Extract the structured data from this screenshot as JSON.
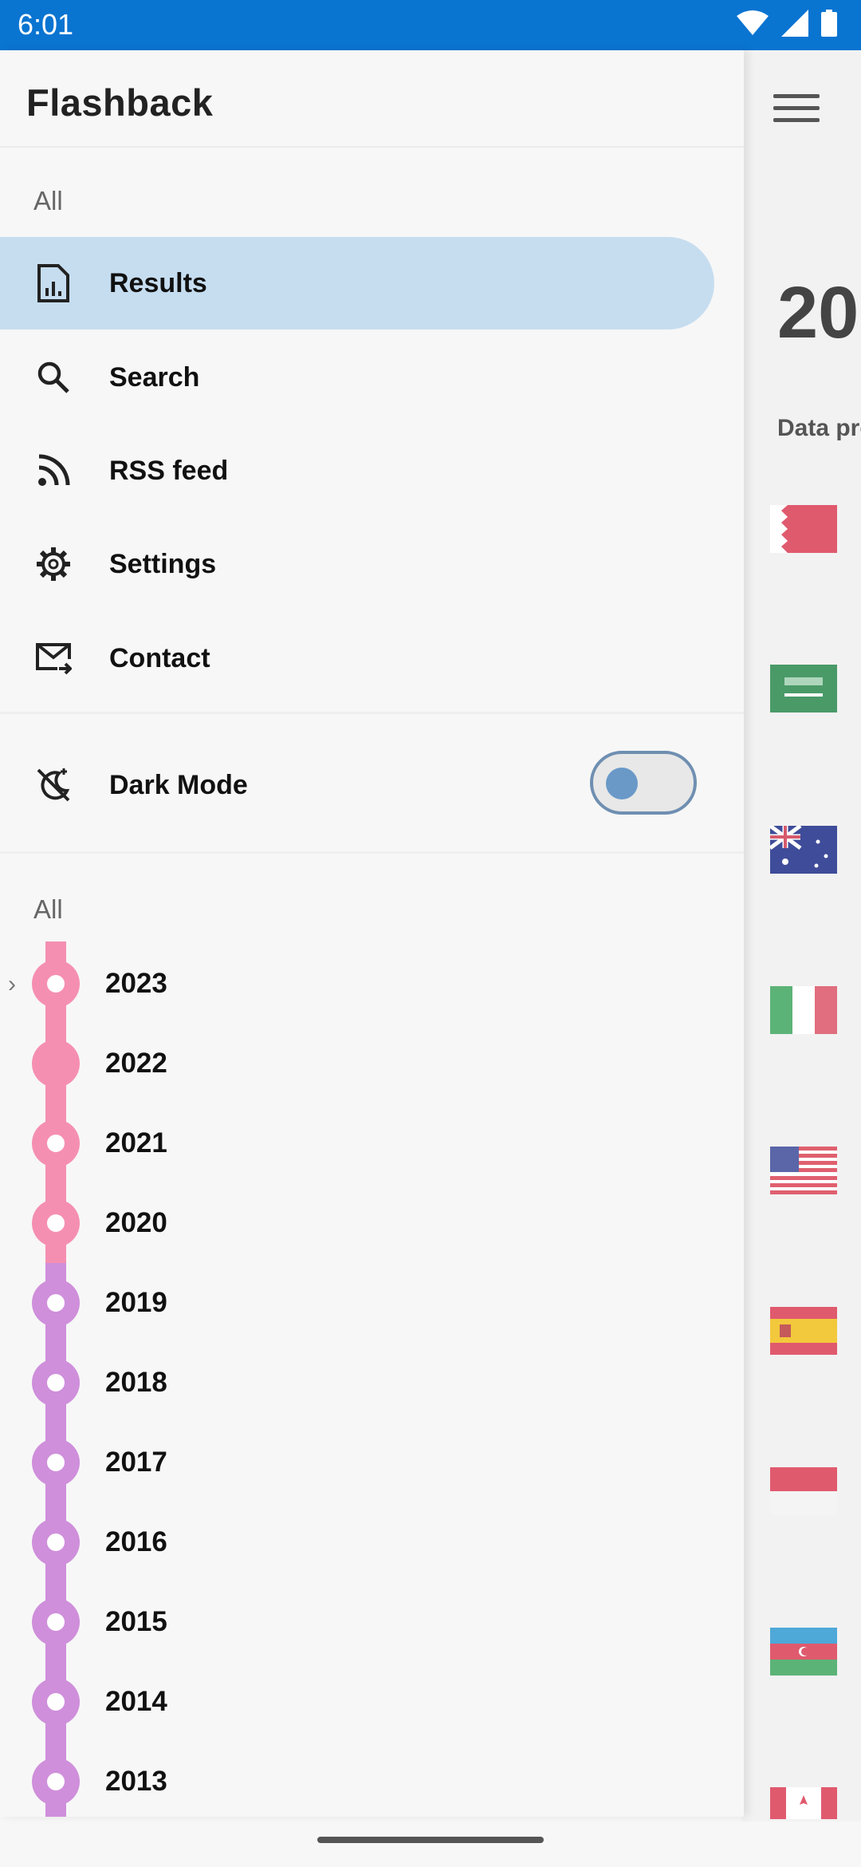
{
  "status_bar": {
    "time": "6:01"
  },
  "drawer": {
    "title": "Flashback",
    "section_all_1": "All",
    "nav_items": [
      {
        "label": "Results",
        "icon": "results-report-icon",
        "active": true
      },
      {
        "label": "Search",
        "icon": "search-icon",
        "active": false
      },
      {
        "label": "RSS feed",
        "icon": "rss-icon",
        "active": false
      },
      {
        "label": "Settings",
        "icon": "gear-icon",
        "active": false
      },
      {
        "label": "Contact",
        "icon": "mail-icon",
        "active": false
      }
    ],
    "dark_mode": {
      "label": "Dark Mode",
      "enabled": false
    },
    "section_all_2": "All",
    "years": [
      "2023",
      "2022",
      "2021",
      "2020",
      "2019",
      "2018",
      "2017",
      "2016",
      "2015",
      "2014",
      "2013"
    ],
    "colors": {
      "active_bg": "#c6ddf0",
      "timeline_pink": "#f58fb1",
      "timeline_purple": "#cf8fdb"
    }
  },
  "main": {
    "big_year_partial": "20",
    "subtitle_partial": "Data pro"
  }
}
